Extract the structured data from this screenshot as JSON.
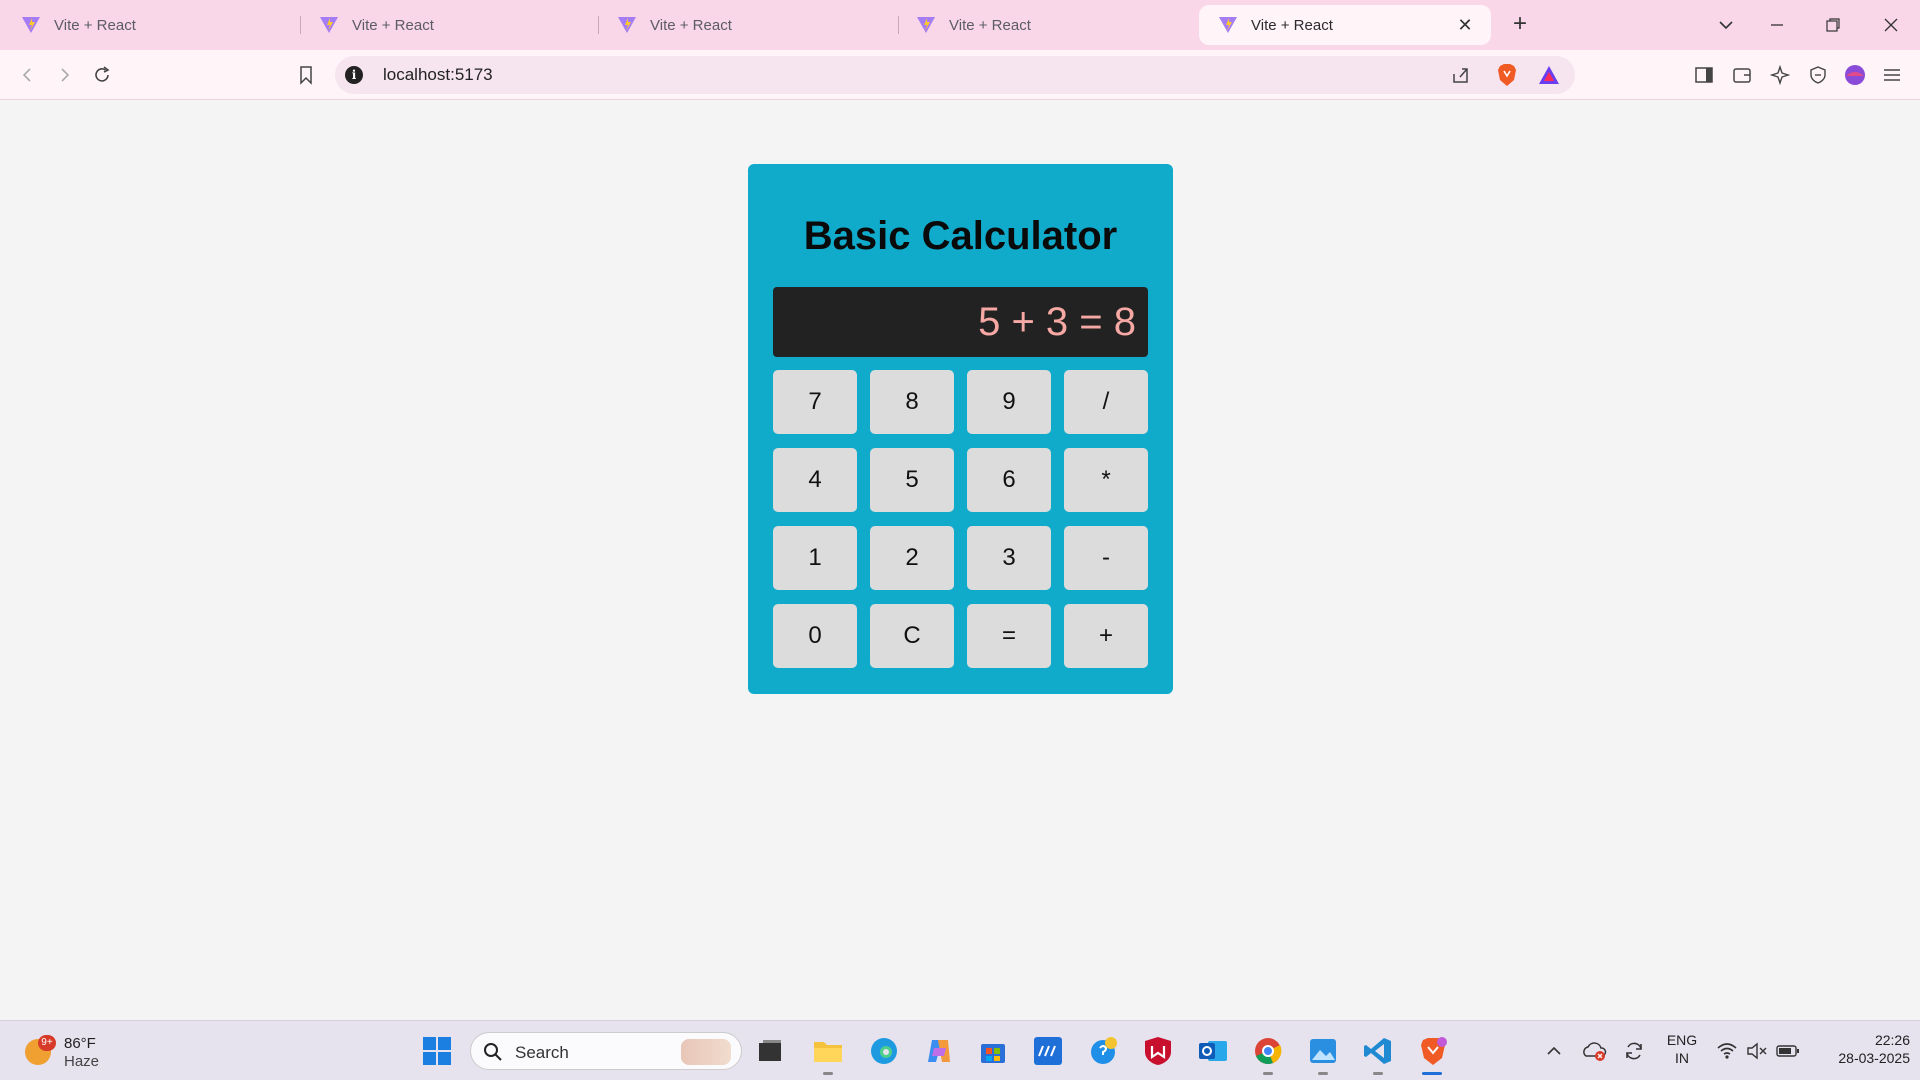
{
  "browser": {
    "tabs": [
      {
        "title": "Vite + React",
        "active": false
      },
      {
        "title": "Vite + React",
        "active": false
      },
      {
        "title": "Vite + React",
        "active": false
      },
      {
        "title": "Vite + React",
        "active": false
      },
      {
        "title": "Vite + React",
        "active": true
      }
    ],
    "url": "localhost:5173"
  },
  "calculator": {
    "title": "Basic Calculator",
    "display": "5 + 3 = 8",
    "keys": [
      "7",
      "8",
      "9",
      "/",
      "4",
      "5",
      "6",
      "*",
      "1",
      "2",
      "3",
      "-",
      "0",
      "C",
      "=",
      "+"
    ]
  },
  "taskbar": {
    "weather": {
      "temp": "86°F",
      "condition": "Haze",
      "badge": "9+"
    },
    "search_placeholder": "Search",
    "language": {
      "line1": "ENG",
      "line2": "IN"
    },
    "time": "22:26",
    "date": "28-03-2025"
  },
  "colors": {
    "calculator_bg": "#10aacb",
    "display_bg": "#222222",
    "display_text": "#f6a8a4",
    "key_bg": "#dcdcdc",
    "tabstrip_bg": "#f9d6e8"
  }
}
